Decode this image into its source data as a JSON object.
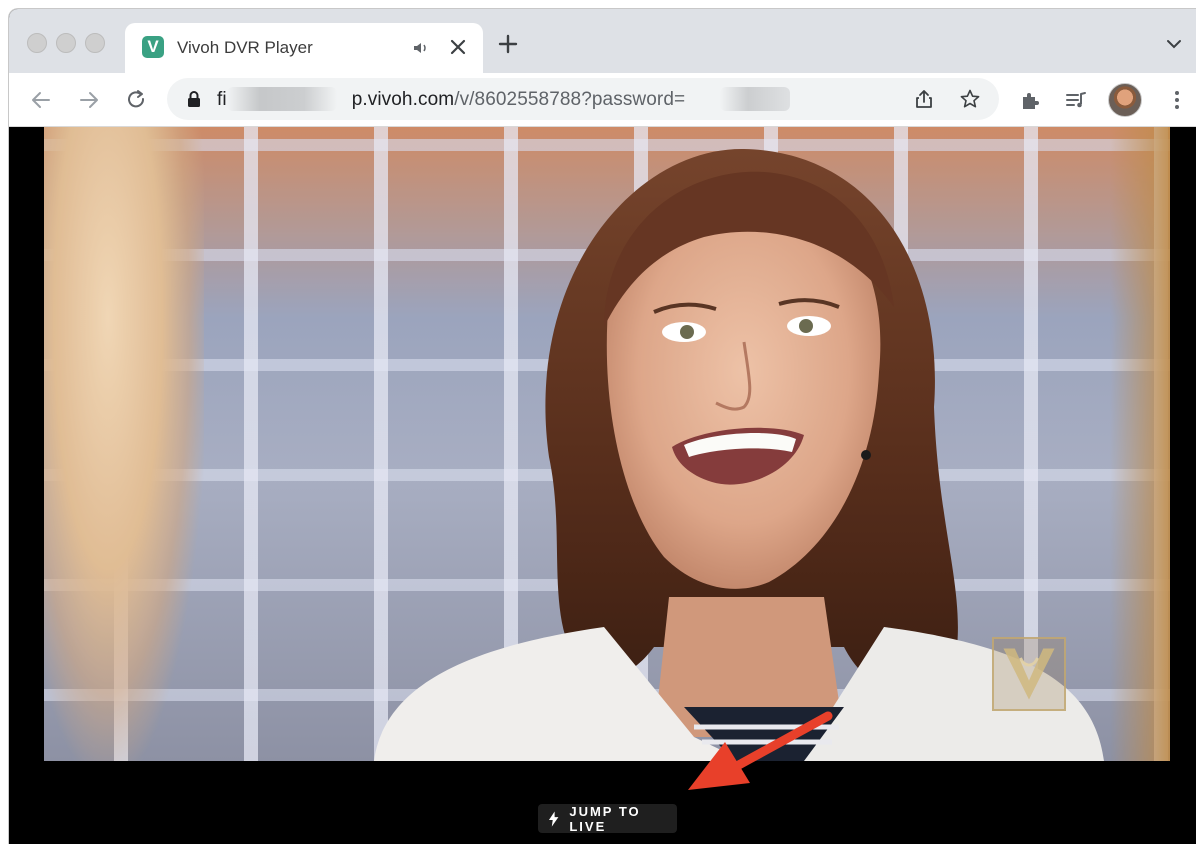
{
  "browser": {
    "tab": {
      "title": "Vivoh DVR Player",
      "favicon_letter": "V"
    },
    "address_bar": {
      "url_prefix": "fi",
      "url_host_visible": "p.vivoh.com",
      "url_path": "/v/8602558788?password="
    }
  },
  "player": {
    "jump_to_live_label": "JUMP TO LIVE"
  },
  "colors": {
    "favicon": "#3aa183",
    "annotation_arrow": "#e8402a",
    "jump_button_bg": "#1f1f1f"
  },
  "icons": {
    "tab_audio": "speaker-icon",
    "tab_close": "close-icon",
    "new_tab": "plus-icon",
    "tab_search": "chevron-down-icon",
    "back": "arrow-left-icon",
    "forward": "arrow-right-icon",
    "reload": "reload-icon",
    "lock": "lock-icon",
    "share": "share-icon",
    "bookmark": "star-icon",
    "extensions": "puzzle-icon",
    "media": "media-queue-icon",
    "menu": "kebab-menu-icon",
    "jump": "bolt-icon"
  }
}
